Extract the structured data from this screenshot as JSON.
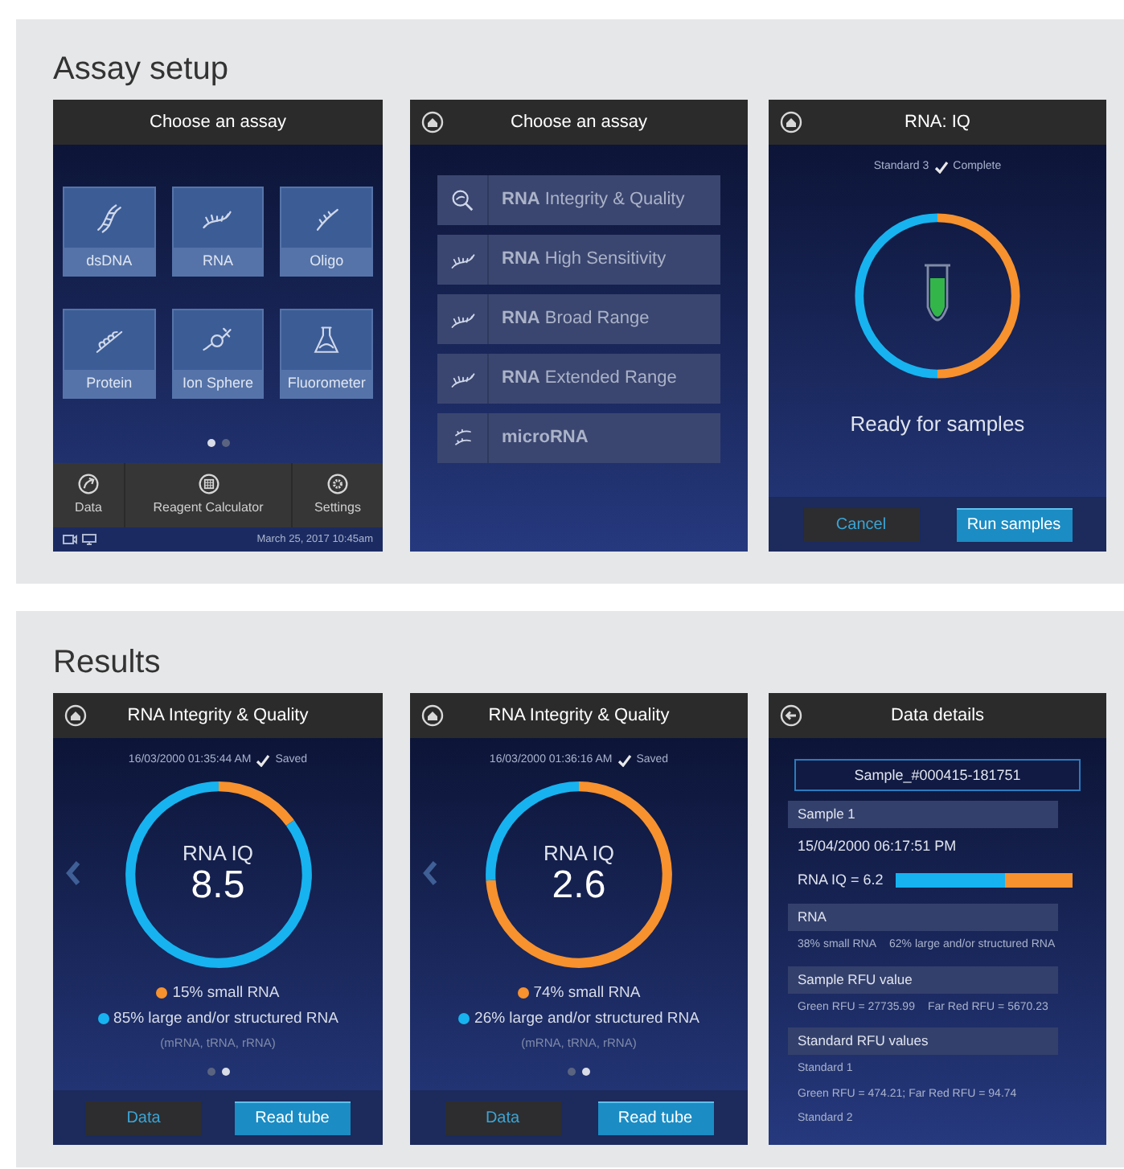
{
  "sections": [
    {
      "title": "Assay setup",
      "screens": [
        {
          "kind": "assay_grid",
          "header": {
            "title": "Choose an assay"
          },
          "tiles": [
            {
              "label": "dsDNA"
            },
            {
              "label": "RNA"
            },
            {
              "label": "Oligo"
            },
            {
              "label": "Protein"
            },
            {
              "label": "Ion Sphere"
            },
            {
              "label": "Fluorometer"
            }
          ],
          "pager": [
            {
              "selected": true
            },
            {
              "selected": false
            }
          ],
          "toolbar": [
            {
              "label": "Data"
            },
            {
              "label": "Reagent Calculator"
            },
            {
              "label": "Settings"
            }
          ],
          "status_bar": {
            "datetime": "March 25, 2017 10:45am"
          }
        },
        {
          "kind": "assay_list",
          "header": {
            "title": "Choose an assay"
          },
          "items": [
            {
              "label": "**RNA** Integrity & Quality"
            },
            {
              "label": "**RNA** High Sensitivity"
            },
            {
              "label": "**RNA** Broad Range"
            },
            {
              "label": "**RNA** Extended Range"
            },
            {
              "label": "**microRNA**"
            }
          ]
        },
        {
          "kind": "ready",
          "header": {
            "title": "RNA: IQ"
          },
          "status_line": "Standard 3",
          "status_note": "Complete",
          "message": "Ready for samples",
          "buttons": [
            {
              "label": "Cancel",
              "primary": false
            },
            {
              "label": "Run samples",
              "primary": true
            }
          ]
        }
      ]
    },
    {
      "title": "Results",
      "screens": [
        {
          "kind": "result",
          "header": {
            "title": "RNA Integrity & Quality"
          },
          "timestamp": "16/03/2000 01:35:44 AM",
          "status_note": "Saved",
          "chart_data": {
            "type": "donut",
            "values": [
              15,
              85
            ]
          },
          "ring_label": "RNA IQ",
          "score": "8.5",
          "legend": [
            {
              "text": "15% small RNA",
              "color": "#f7922e"
            },
            {
              "text": "85% large and/or structured RNA",
              "color": "#17b3f0"
            }
          ],
          "note": "(mRNA, tRNA, rRNA)",
          "pager": [
            {
              "selected": false
            },
            {
              "selected": true
            }
          ],
          "buttons": [
            {
              "label": "Data",
              "primary": false
            },
            {
              "label": "Read tube",
              "primary": true
            }
          ]
        },
        {
          "kind": "result",
          "header": {
            "title": "RNA Integrity & Quality"
          },
          "timestamp": "16/03/2000 01:36:16 AM",
          "status_note": "Saved",
          "chart_data": {
            "type": "donut",
            "values": [
              74,
              26
            ]
          },
          "ring_label": "RNA IQ",
          "score": "2.6",
          "legend": [
            {
              "text": "74% small RNA",
              "color": "#f7922e"
            },
            {
              "text": "26% large and/or structured RNA",
              "color": "#17b3f0"
            }
          ],
          "note": "(mRNA, tRNA, rRNA)",
          "pager": [
            {
              "selected": false
            },
            {
              "selected": true
            }
          ],
          "buttons": [
            {
              "label": "Data",
              "primary": false
            },
            {
              "label": "Read tube",
              "primary": true
            }
          ]
        },
        {
          "kind": "details",
          "header": {
            "title": "Data details"
          },
          "sample_name": "Sample_#000415-181751",
          "blocks": [
            {
              "heading": "Sample 1",
              "rows": [
                {
                  "kind": "text",
                  "texts": [
                    "15/04/2000 06:17:51 PM"
                  ]
                },
                {
                  "kind": "bar",
                  "texts": [
                    "RNA IQ = 6.2"
                  ],
                  "level": 0.38
                }
              ]
            },
            {
              "heading": "RNA",
              "rows": [
                {
                  "kind": "small",
                  "texts": [
                    "38% small RNA",
                    "62% large and/or structured RNA"
                  ]
                }
              ]
            },
            {
              "heading": "Sample RFU value",
              "rows": [
                {
                  "kind": "small",
                  "texts": [
                    "Green RFU = 27735.99",
                    "Far Red RFU = 5670.23"
                  ]
                }
              ]
            },
            {
              "heading": "Standard RFU values",
              "rows": [
                {
                  "kind": "small",
                  "texts": [
                    "Standard 1"
                  ]
                },
                {
                  "kind": "small",
                  "texts": [
                    "Green RFU = 474.21; Far Red RFU = 94.74"
                  ]
                },
                {
                  "kind": "small",
                  "texts": [
                    "Standard 2"
                  ]
                }
              ]
            }
          ]
        }
      ]
    }
  ]
}
